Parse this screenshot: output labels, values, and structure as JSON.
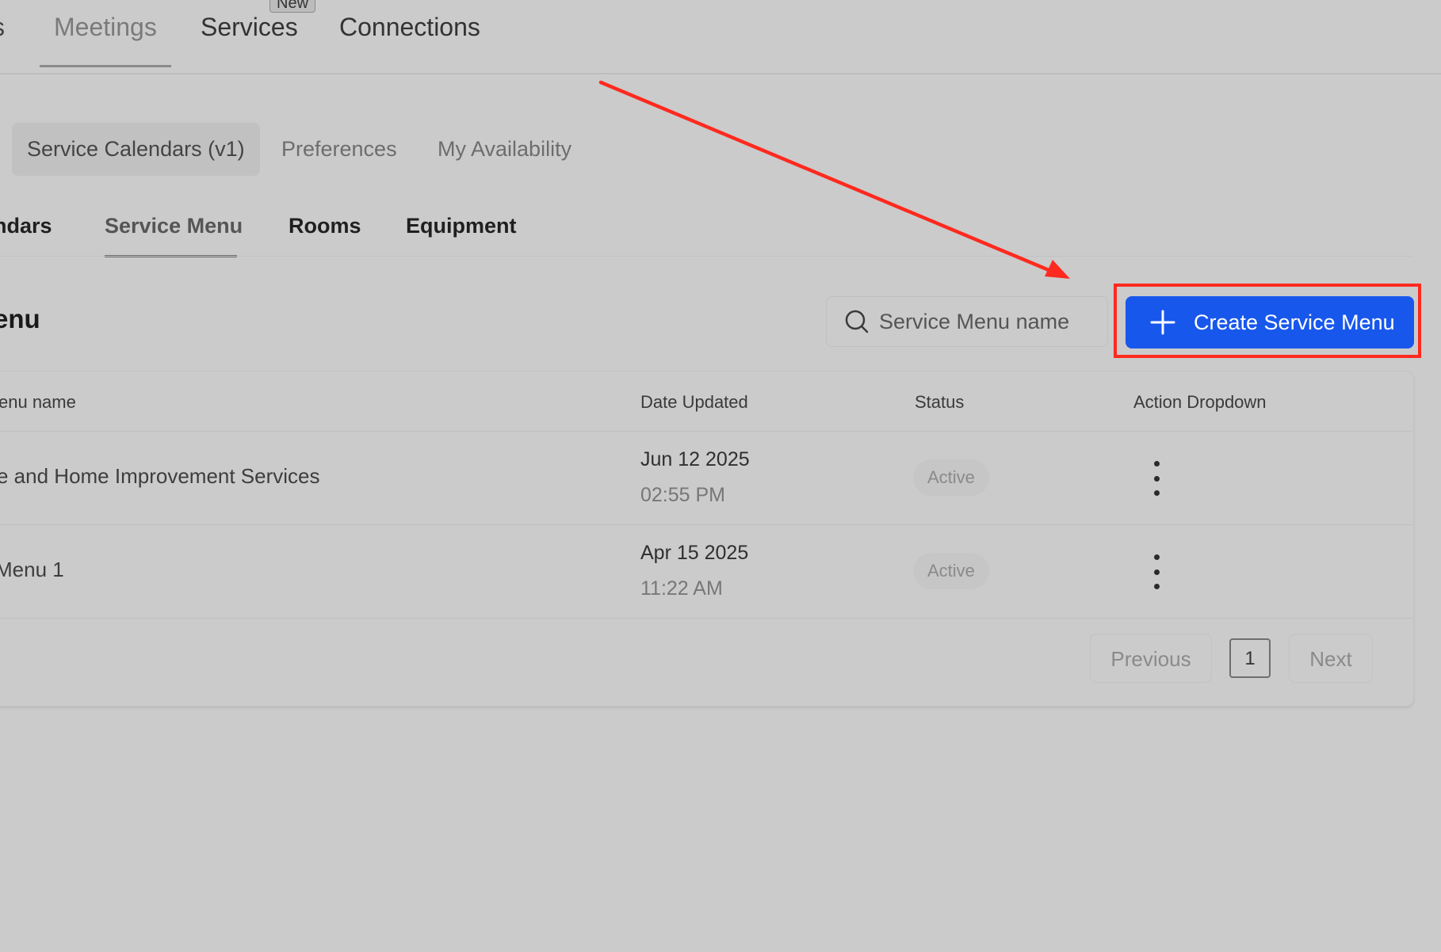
{
  "topnav": {
    "cut_tab": "s",
    "meetings": "Meetings",
    "services": "Services",
    "services_badge": "New",
    "connections": "Connections"
  },
  "subtabs": {
    "service_calendars": "Service Calendars (v1)",
    "preferences": "Preferences",
    "my_availability": "My Availability"
  },
  "tertiary_tabs": {
    "calendars": "ndars",
    "service_menu": "Service Menu",
    "rooms": "Rooms",
    "equipment": "Equipment"
  },
  "section": {
    "title": "enu",
    "search_placeholder": "Service Menu name",
    "create_button": "Create Service Menu"
  },
  "table": {
    "headers": {
      "name": "enu name",
      "date_updated": "Date Updated",
      "status": "Status",
      "action": "Action Dropdown"
    },
    "rows": [
      {
        "name": "e and Home Improvement Services",
        "date": "Jun 12 2025",
        "time": "02:55 PM",
        "status": "Active"
      },
      {
        "name": "Menu 1",
        "date": "Apr 15 2025",
        "time": "11:22 AM",
        "status": "Active"
      }
    ]
  },
  "pagination": {
    "previous": "Previous",
    "page": "1",
    "next": "Next"
  },
  "colors": {
    "primary": "#1757ec",
    "annotation": "#ff2a1f",
    "background": "#cbcbcb"
  }
}
